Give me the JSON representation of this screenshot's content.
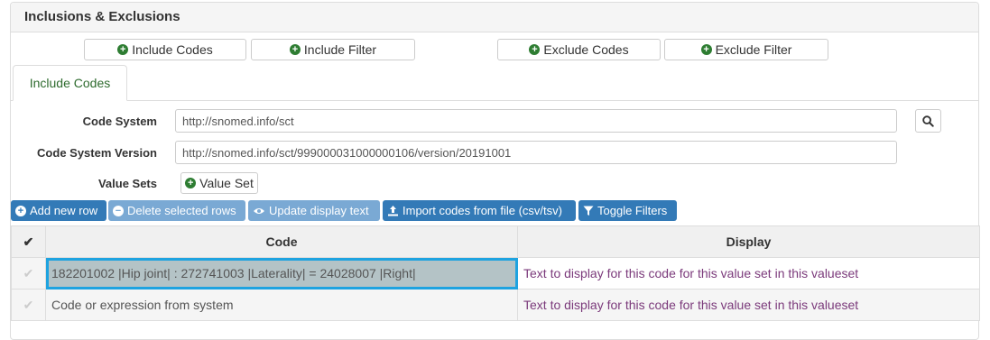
{
  "panel": {
    "title": "Inclusions & Exclusions"
  },
  "actions": {
    "include_codes": "Include Codes",
    "include_filter": "Include Filter",
    "exclude_codes": "Exclude Codes",
    "exclude_filter": "Exclude Filter"
  },
  "tabs": [
    {
      "label": "Include Codes",
      "active": true
    }
  ],
  "form": {
    "code_system_label": "Code System",
    "code_system_value": "http://snomed.info/sct",
    "code_system_version_label": "Code System Version",
    "code_system_version_value": "http://snomed.info/sct/999000031000000106/version/20191001",
    "value_sets_label": "Value Sets",
    "value_set_button": "Value Set"
  },
  "toolbar": {
    "add_new_row": "Add new row",
    "delete_selected_rows": "Delete selected rows",
    "update_display_text": "Update display text",
    "import_codes": "Import codes from file (csv/tsv)",
    "toggle_filters": "Toggle Filters"
  },
  "grid": {
    "columns": [
      "Code",
      "Display"
    ],
    "rows": [
      {
        "code": "182201002 |Hip joint| : 272741003 |Laterality| = 24028007 |Right|",
        "display": "Text to display for this code for this value set in this valueset",
        "selected": true
      },
      {
        "code": "Code or expression from system",
        "display": "Text to display for this code for this value set in this valueset",
        "selected": false
      }
    ]
  },
  "colors": {
    "accent": "#337ab7",
    "green_icon": "#2e7d32",
    "selection_outline": "#1ea3e0",
    "display_text": "#7b3a7b"
  }
}
